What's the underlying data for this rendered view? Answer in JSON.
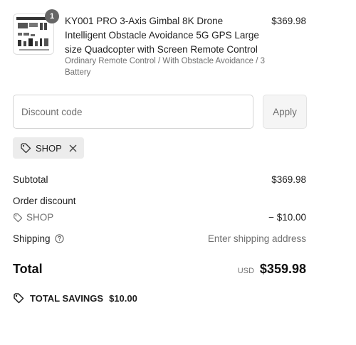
{
  "product": {
    "quantity": "1",
    "title": "KY001 PRO 3-Axis Gimbal 8K Drone Intelligent Obstacle Avoidance 5G GPS Large size Quadcopter with Screen Remote Control",
    "variant": "Ordinary Remote Control / With Obstacle Avoidance / 3 Battery",
    "price": "$369.98",
    "image_icon": "product-image"
  },
  "discount": {
    "placeholder": "Discount code",
    "apply_label": "Apply",
    "applied_code": "SHOP",
    "remove_icon": "close-icon"
  },
  "summary": {
    "subtotal_label": "Subtotal",
    "subtotal_value": "$369.98",
    "order_discount_label": "Order discount",
    "discount_code": "SHOP",
    "discount_value": "− $10.00",
    "shipping_label": "Shipping",
    "shipping_value": "Enter shipping address",
    "total_label": "Total",
    "currency": "USD",
    "total_value": "$359.98",
    "savings_label": "TOTAL SAVINGS",
    "savings_value": "$10.00"
  },
  "colors": {
    "text": "#1f1f1f",
    "muted": "#707070",
    "badge": "#666666",
    "chip_bg": "#ececec"
  }
}
